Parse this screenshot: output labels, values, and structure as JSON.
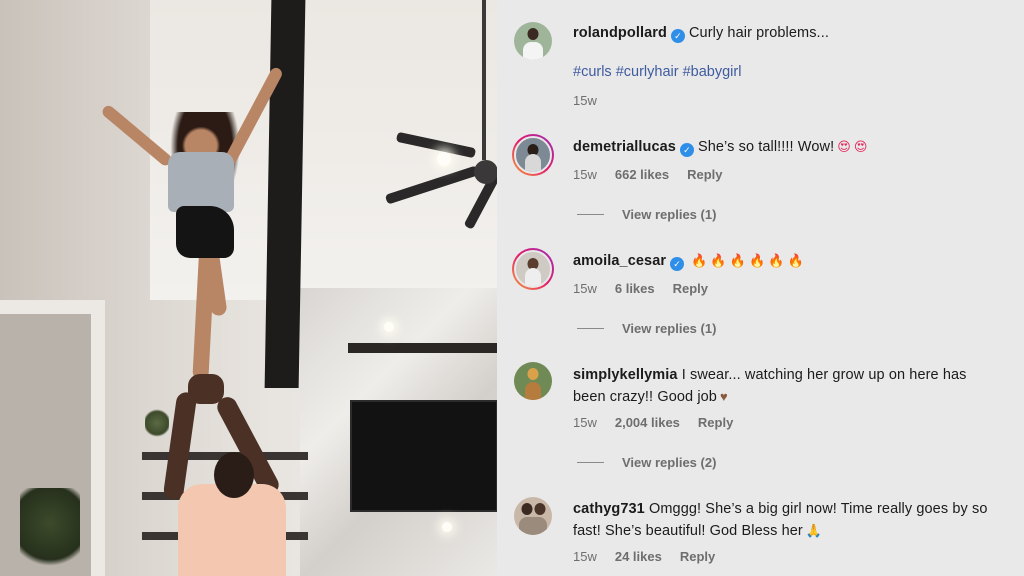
{
  "caption": {
    "username": "rolandpollard",
    "text": "Curly hair problems...",
    "hashtags": "#curls #curlyhair #babygirl",
    "time": "15w"
  },
  "comments": [
    {
      "username": "demetriallucas",
      "verified": true,
      "text": "She’s so tall!!!! Wow!",
      "emoji_name": "smiling-face-with-heart-eyes",
      "time": "15w",
      "likes": "662 likes",
      "reply_label": "Reply",
      "view_replies": "View replies (1)"
    },
    {
      "username": "amoila_cesar",
      "verified": true,
      "text": "",
      "emoji_name": "fire x6",
      "time": "15w",
      "likes": "6 likes",
      "reply_label": "Reply",
      "view_replies": "View replies (1)"
    },
    {
      "username": "simplykellymia",
      "verified": false,
      "text": "I swear... watching her grow up on here has been crazy!! Good job",
      "emoji_name": "heart",
      "time": "15w",
      "likes": "2,004 likes",
      "reply_label": "Reply",
      "view_replies": "View replies (2)"
    },
    {
      "username": "cathyg731",
      "verified": false,
      "text": "Omggg! She’s a big girl now! Time really goes by so fast! She’s beautiful! God Bless her",
      "emoji_name": "folded-hands",
      "time": "15w",
      "likes": "24 likes",
      "reply_label": "Reply"
    }
  ],
  "colors": {
    "verified": "#2f8fe8",
    "hashtag": "#3f5b9f",
    "story_ring": "#e3196b",
    "panel_bg": "#e9e9e9"
  }
}
